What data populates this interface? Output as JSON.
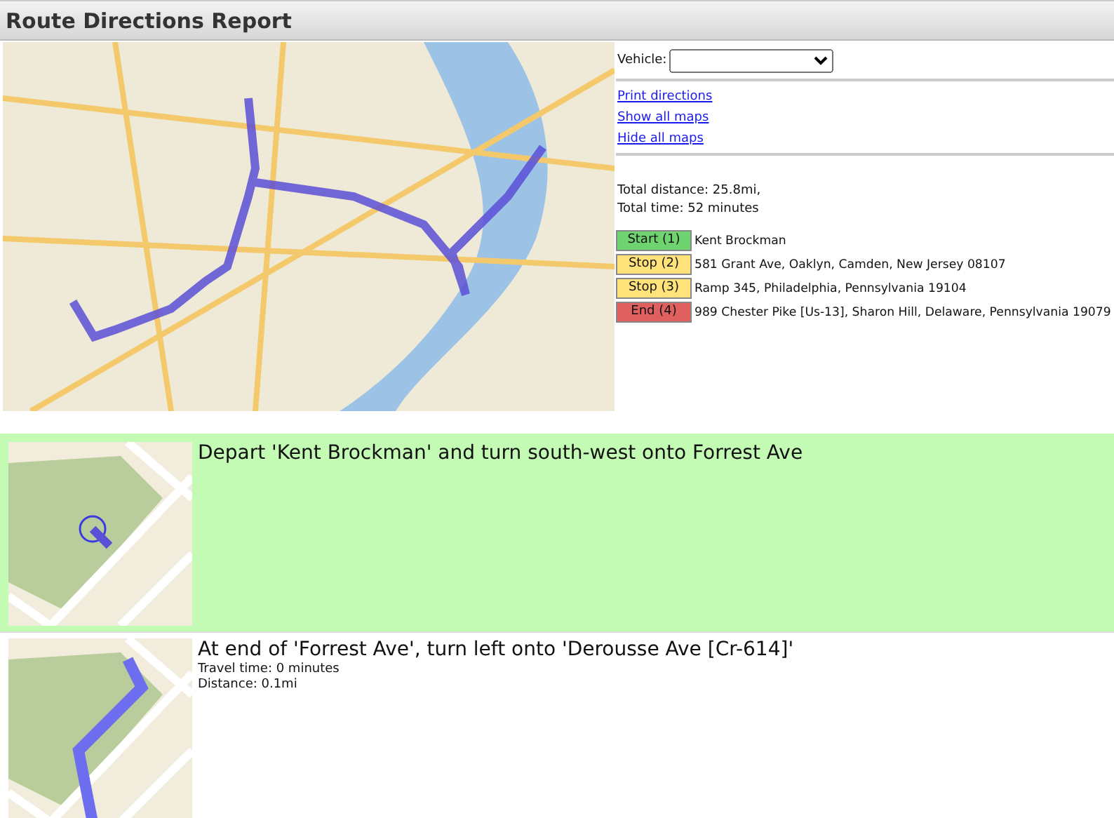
{
  "window": {
    "title": "Route Directions Report"
  },
  "vehicle": {
    "label": "Vehicle:"
  },
  "links": [
    "Print directions",
    "Show all maps",
    "Hide all maps"
  ],
  "summary": [
    "Total distance: 25.8mi,",
    "Total time: 52 minutes"
  ],
  "stops": [
    {
      "label": "Start (1)",
      "color": "#6fd46f",
      "address": "Kent Brockman"
    },
    {
      "label": "Stop (2)",
      "color": "#ffe37a",
      "address": "581 Grant Ave, Oaklyn, Camden, New Jersey 08107"
    },
    {
      "label": "Stop (3)",
      "color": "#ffe37a",
      "address": "Ramp 345, Philadelphia, Pennsylvania 19104"
    },
    {
      "label": "End (4)",
      "color": "#e06060",
      "address": "989 Chester Pike [Us-13], Sharon Hill, Delaware, Pennsylvania 19079"
    }
  ],
  "steps": [
    {
      "selected": true,
      "instruction": "Depart 'Kent Brockman' and turn south-west onto Forrest Ave"
    },
    {
      "selected": false,
      "instruction": "At end of 'Forrest Ave', turn left onto 'Derousse Ave [Cr-614]'",
      "details": [
        "Travel time: 0 minutes",
        "Distance: 0.1mi"
      ]
    }
  ]
}
